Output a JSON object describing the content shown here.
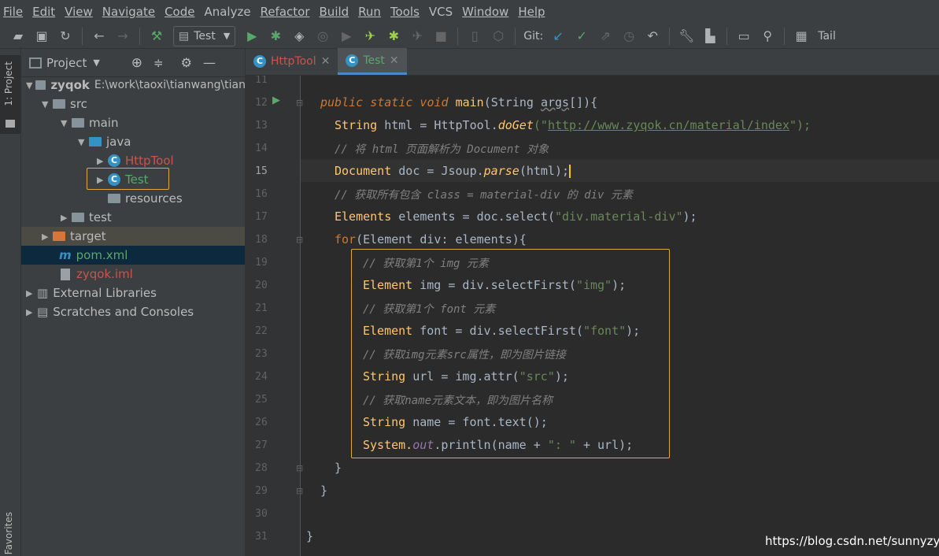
{
  "menu": [
    "File",
    "Edit",
    "View",
    "Navigate",
    "Code",
    "Analyze",
    "Refactor",
    "Build",
    "Run",
    "Tools",
    "VCS",
    "Window",
    "Help"
  ],
  "toolbar": {
    "run_config": "Test",
    "git_label": "Git:",
    "tail_label": "Tail"
  },
  "left_strip": {
    "project_label": "1: Project",
    "favorites_label": "Favorites"
  },
  "project_panel": {
    "title": "Project",
    "tree": [
      {
        "label": "zyqok",
        "path": "E:\\work\\taoxi\\tianwang\\tian"
      },
      {
        "label": "src"
      },
      {
        "label": "main"
      },
      {
        "label": "java"
      },
      {
        "label": "HttpTool"
      },
      {
        "label": "Test"
      },
      {
        "label": "resources"
      },
      {
        "label": "test"
      },
      {
        "label": "target"
      },
      {
        "label": "pom.xml"
      },
      {
        "label": "zyqok.iml"
      },
      {
        "label": "External Libraries"
      },
      {
        "label": "Scratches and Consoles"
      }
    ]
  },
  "tabs": [
    {
      "label": "HttpTool"
    },
    {
      "label": "Test"
    }
  ],
  "line_numbers": [
    "11",
    "12",
    "13",
    "14",
    "15",
    "16",
    "17",
    "18",
    "19",
    "20",
    "21",
    "22",
    "23",
    "24",
    "25",
    "26",
    "27",
    "28",
    "29",
    "30",
    "31"
  ],
  "code": {
    "l12": {
      "kw": "public static void",
      "name": "main",
      "params": "(String ",
      "arg": "args",
      "rest": "[]){"
    },
    "l13": {
      "type": "String",
      "a": " html = HttpTool.",
      "call": "doGet",
      "b": "(\"",
      "url": "http://www.zyqok.cn/material/index",
      "c": "\");"
    },
    "l14": "// 将 html 页面解析为 Document 对象",
    "l15": {
      "type": "Document",
      "a": " doc = Jsoup.",
      "call": "parse",
      "b": "(html);"
    },
    "l16": "// 获取所有包含 class = material-div 的 div 元素",
    "l17": {
      "type": "Elements",
      "a": " elements = doc.",
      "call": "select",
      "b": "(",
      "s": "\"div.material-div\"",
      "c": ");"
    },
    "l18": {
      "kw": "for",
      "a": "(Element div: elements){"
    },
    "l19": "// 获取第1个 img 元素",
    "l20": {
      "type": "Element",
      "a": " img = div.",
      "call": "selectFirst",
      "b": "(",
      "s": "\"img\"",
      "c": ");"
    },
    "l21": "// 获取第1个 font 元素",
    "l22": {
      "type": "Element",
      "a": " font = div.",
      "call": "selectFirst",
      "b": "(",
      "s": "\"font\"",
      "c": ");"
    },
    "l23": "// 获取img元素src属性，即为图片链接",
    "l24": {
      "type": "String",
      "a": " url = img.",
      "call": "attr",
      "b": "(",
      "s": "\"src\"",
      "c": ");"
    },
    "l25": "// 获取name元素文本，即为图片名称",
    "l26": {
      "type": "String",
      "a": " name = font.",
      "call": "text",
      "b": "();"
    },
    "l27": {
      "a": "System.",
      "out": "out",
      "b": ".",
      "call": "println",
      "c": "(name + ",
      "s": "\": \"",
      "d": " + url);"
    },
    "l28": "}",
    "l29": "}",
    "l31": "}"
  },
  "watermark": "https://blog.csdn.net/sunnyzyq",
  "colors": {
    "accent": "#e0a93e",
    "run_green": "#59a869",
    "keyword": "#cc7832",
    "string": "#6a8759"
  }
}
